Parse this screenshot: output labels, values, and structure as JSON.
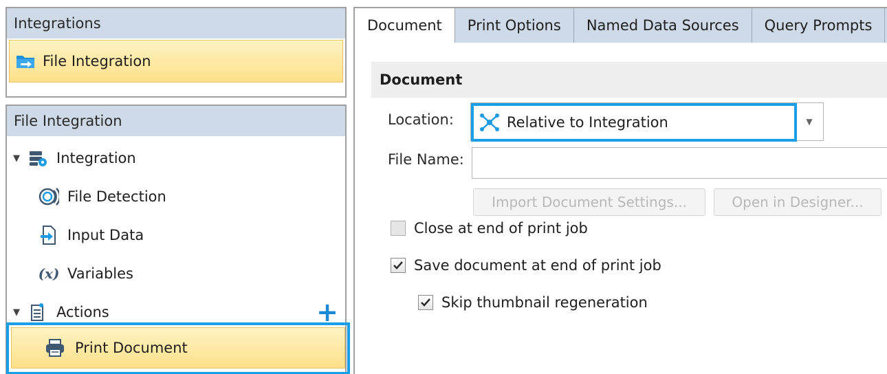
{
  "integrations_panel": {
    "header": "Integrations",
    "items": [
      {
        "label": "File Integration",
        "icon": "folder-arrow-icon",
        "selected": true
      }
    ]
  },
  "tree_panel": {
    "header": "File Integration",
    "items": [
      {
        "label": "Integration",
        "icon": "integration-icon",
        "expanded": true
      },
      {
        "label": "File Detection",
        "icon": "file-detection-icon"
      },
      {
        "label": "Input Data",
        "icon": "input-data-icon"
      },
      {
        "label": "Variables",
        "icon": "variables-icon",
        "icon_text": "(x)"
      },
      {
        "label": "Actions",
        "icon": "actions-icon",
        "expanded": true
      },
      {
        "label": "Print Document",
        "icon": "printer-icon",
        "selected": true
      }
    ],
    "add_icon": "plus-icon"
  },
  "tabs": [
    {
      "label": "Document",
      "active": true
    },
    {
      "label": "Print Options",
      "active": false
    },
    {
      "label": "Named Data Sources",
      "active": false
    },
    {
      "label": "Query Prompts",
      "active": false
    }
  ],
  "document_section": {
    "title": "Document",
    "location_label": "Location:",
    "location_value": "Relative to Integration",
    "location_icon": "relative-nodes-icon",
    "filename_label": "File Name:",
    "filename_value": "",
    "import_button": "Import Document Settings...",
    "designer_button": "Open in Designer...",
    "checkboxes": [
      {
        "label": "Close at end of print job",
        "checked": false
      },
      {
        "label": "Save document at end of print job",
        "checked": true
      },
      {
        "label": "Skip thumbnail regeneration",
        "checked": true
      }
    ]
  },
  "colors": {
    "accent_blue": "#1a9ee6",
    "header_blue": "#cfdae8",
    "selection_yellow": "#fde08a"
  }
}
